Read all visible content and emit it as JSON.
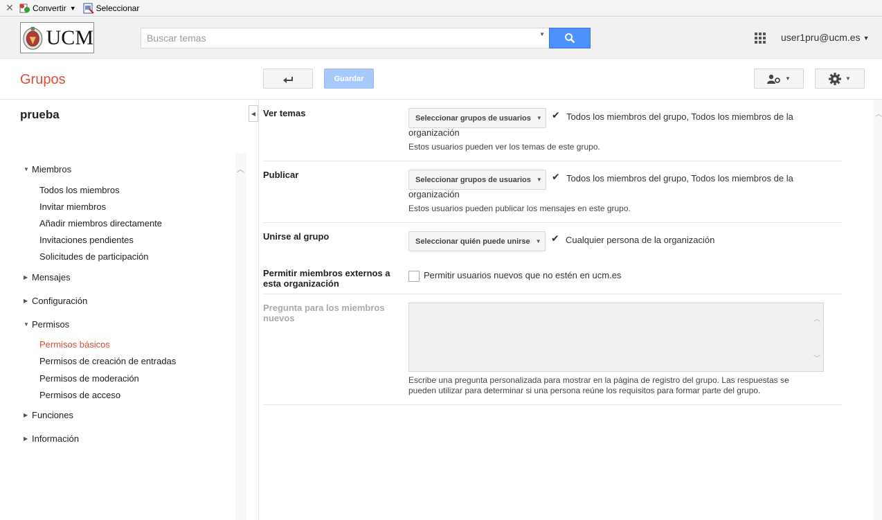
{
  "toolbar": {
    "convert": "Convertir",
    "select": "Seleccionar"
  },
  "header": {
    "logo_text": "UCM",
    "search_placeholder": "Buscar temas",
    "user": "user1pru@ucm.es"
  },
  "titlebar": {
    "title": "Grupos",
    "save_label": "Guardar"
  },
  "group_name": "prueba",
  "nav": {
    "members": {
      "label": "Miembros",
      "items": [
        "Todos los miembros",
        "Invitar miembros",
        "Añadir miembros directamente",
        "Invitaciones pendientes",
        "Solicitudes de participación"
      ]
    },
    "messages": "Mensajes",
    "config": "Configuración",
    "permissions": {
      "label": "Permisos",
      "items": [
        "Permisos básicos",
        "Permisos de creación de entradas",
        "Permisos de moderación",
        "Permisos de acceso"
      ]
    },
    "roles": "Funciones",
    "info": "Información"
  },
  "settings": {
    "view": {
      "label": "Ver temas",
      "select": "Seleccionar grupos de usuarios",
      "value_line1": "Todos los miembros del grupo, Todos los miembros de la",
      "value_line2": "organización",
      "desc": "Estos usuarios pueden ver los temas de este grupo."
    },
    "post": {
      "label": "Publicar",
      "select": "Seleccionar grupos de usuarios",
      "value_line1": "Todos los miembros del grupo, Todos los miembros de la",
      "value_line2": "organización",
      "desc": "Estos usuarios pueden publicar los mensajes en este grupo."
    },
    "join": {
      "label": "Unirse al grupo",
      "select": "Seleccionar quién puede unirse",
      "value": "Cualquier persona de la organización"
    },
    "external": {
      "label_line1": "Permitir miembros externos a",
      "label_line2": "esta organización",
      "checkbox_label": "Permitir usuarios nuevos que no estén en ucm.es"
    },
    "question": {
      "label_line1": "Pregunta para los miembros",
      "label_line2": "nuevos",
      "desc_line1": "Escribe una pregunta personalizada para mostrar en la página de registro del grupo. Las respuestas se",
      "desc_line2": "pueden utilizar para determinar si una persona reúne los requisitos para formar parte del grupo."
    }
  }
}
